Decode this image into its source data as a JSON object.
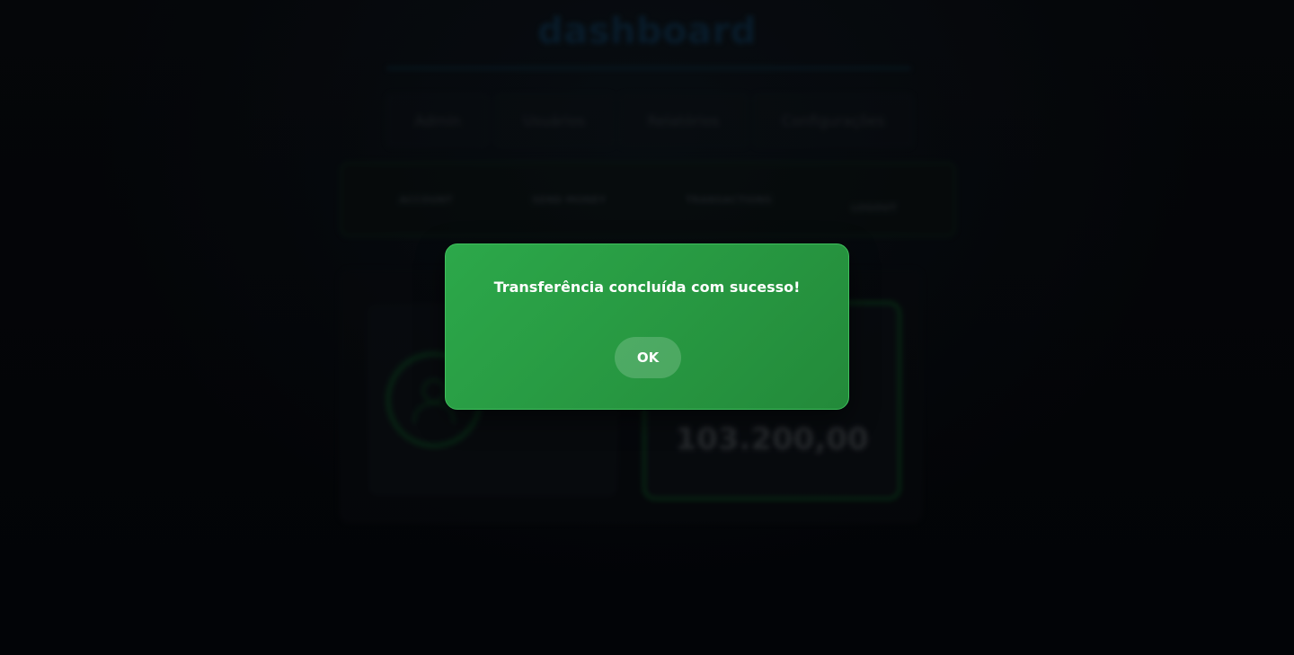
{
  "app": {
    "title": "dashboard",
    "nav": [
      "Admin",
      "Usuários",
      "Relatórios",
      "Configurações"
    ],
    "subnav": [
      "ACCOUNT",
      "SEND MONEY",
      "TRANSACTIONS",
      "LOGOUT"
    ],
    "balance": "103.200,00"
  },
  "dialog": {
    "message": "Transferência concluída com sucesso!",
    "ok_label": "OK"
  },
  "icons": {
    "avatar": "user-icon"
  },
  "colors": {
    "dialog_bg": "#2ca84a",
    "accent_green": "#1f9b3b"
  }
}
